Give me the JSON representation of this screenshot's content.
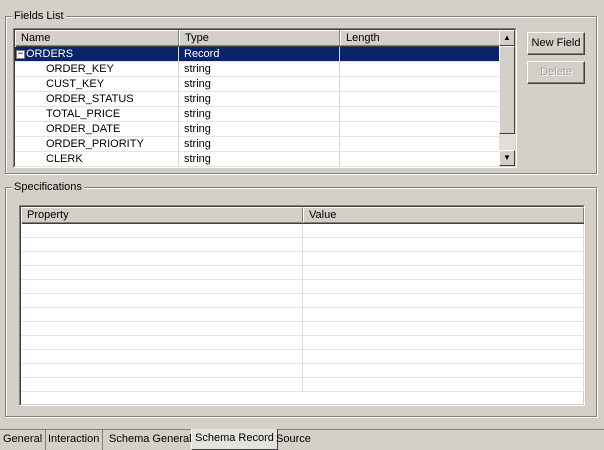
{
  "fields_list": {
    "title": "Fields List",
    "columns": [
      "Name",
      "Type",
      "Length"
    ],
    "rows": [
      {
        "name": "ORDERS",
        "type": "Record",
        "length": "",
        "expander": "−",
        "selected": true
      },
      {
        "name": "ORDER_KEY",
        "type": "string",
        "length": ""
      },
      {
        "name": "CUST_KEY",
        "type": "string",
        "length": ""
      },
      {
        "name": "ORDER_STATUS",
        "type": "string",
        "length": ""
      },
      {
        "name": "TOTAL_PRICE",
        "type": "string",
        "length": ""
      },
      {
        "name": "ORDER_DATE",
        "type": "string",
        "length": ""
      },
      {
        "name": "ORDER_PRIORITY",
        "type": "string",
        "length": ""
      },
      {
        "name": "CLERK",
        "type": "string",
        "length": ""
      }
    ],
    "scroll_up_icon": "▲",
    "scroll_down_icon": "▼"
  },
  "buttons": {
    "new_field": "New Field",
    "delete": "Delete"
  },
  "specifications": {
    "title": "Specifications",
    "columns": [
      "Property",
      "Value"
    ],
    "empty_rows": 12
  },
  "tabs": [
    {
      "label": "General",
      "active": false
    },
    {
      "label": "Interaction",
      "active": false
    },
    {
      "label": "Schema General",
      "active": false
    },
    {
      "label": "Schema Record",
      "active": true
    },
    {
      "label": "Source",
      "active": false
    }
  ],
  "colors": {
    "selection": "#0a246a",
    "window": "#d4d0c8"
  }
}
